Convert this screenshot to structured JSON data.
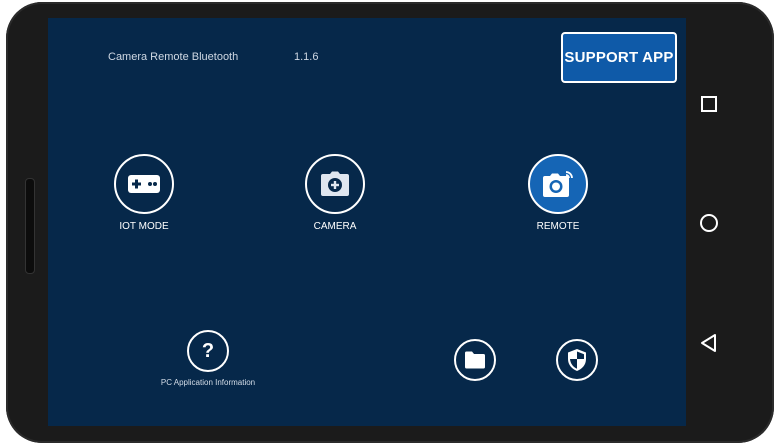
{
  "app": {
    "title": "Camera Remote Bluetooth",
    "version": "1.1.6"
  },
  "support_button": {
    "label": "SUPPORT APP"
  },
  "modes": [
    {
      "label": "IOT MODE",
      "icon": "gamepad-icon"
    },
    {
      "label": "CAMERA",
      "icon": "camera-plus-icon"
    },
    {
      "label": "REMOTE",
      "icon": "camera-wireless-icon"
    }
  ],
  "bottom_actions": [
    {
      "label": "PC Application Information",
      "icon": "question-icon"
    },
    {
      "icon": "folder-icon"
    },
    {
      "icon": "shield-icon"
    }
  ],
  "nav_bar": {
    "icons": [
      "square-icon",
      "circle-icon",
      "triangle-back-icon"
    ]
  },
  "colors": {
    "screen_bg": "#06284a",
    "accent": "#1565b5",
    "button": "#0f5aa8"
  }
}
